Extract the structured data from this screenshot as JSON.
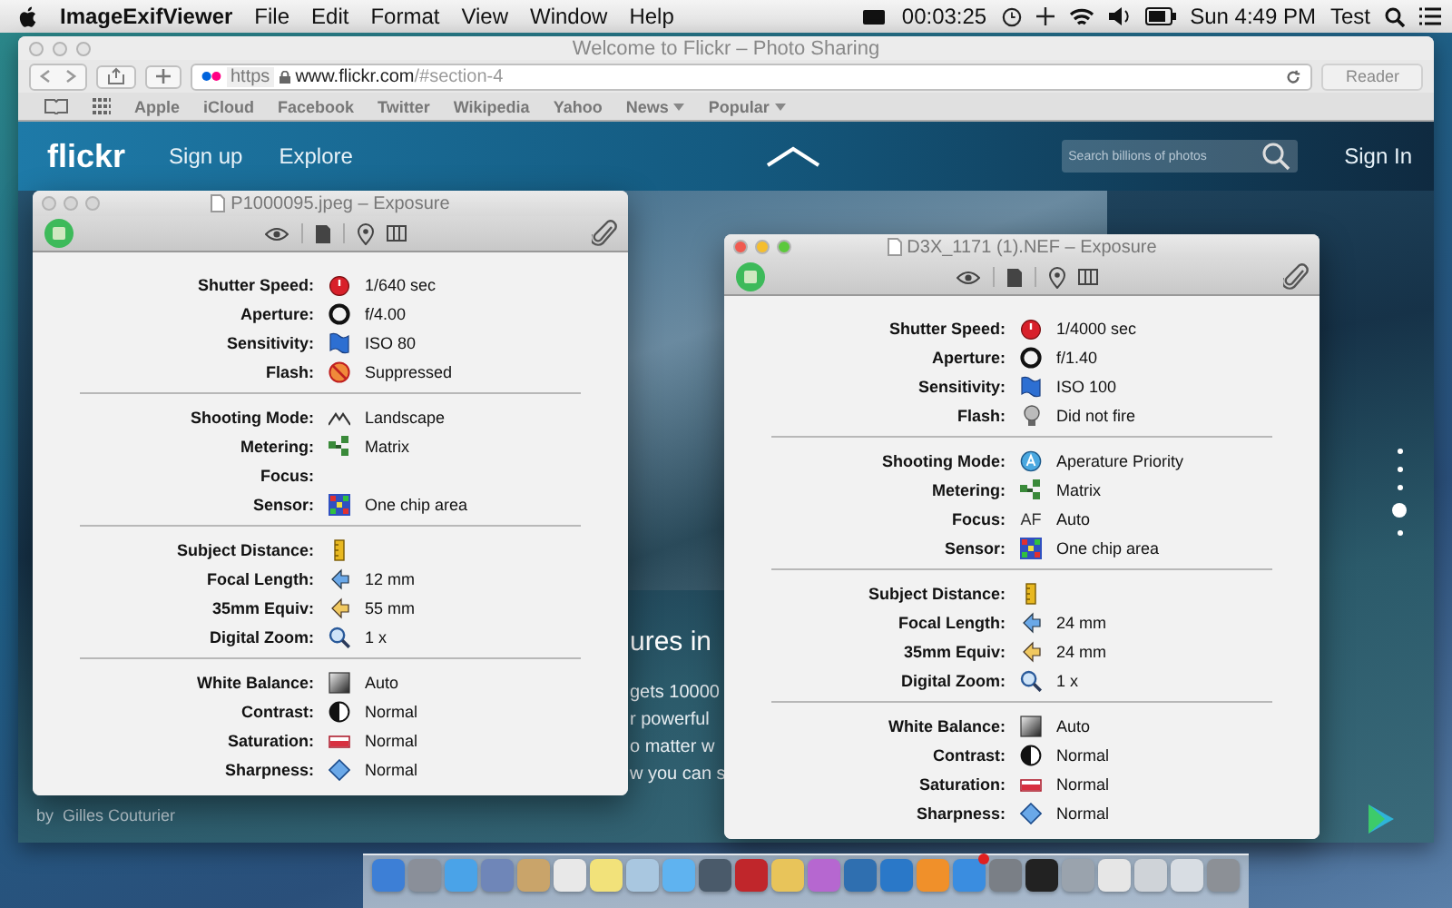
{
  "menubar": {
    "app_name": "ImageExifViewer",
    "menus": [
      "File",
      "Edit",
      "Format",
      "View",
      "Window",
      "Help"
    ],
    "timer": "00:03:25",
    "clock": "Sun 4:49 PM",
    "user": "Test"
  },
  "browser": {
    "title": "Welcome to Flickr – Photo Sharing",
    "url_scheme": "https",
    "url_host": "www.flickr.com",
    "url_path": "/#section-4",
    "reader_button": "Reader",
    "bookmarks": [
      {
        "label": "Apple",
        "menu": false
      },
      {
        "label": "iCloud",
        "menu": false
      },
      {
        "label": "Facebook",
        "menu": false
      },
      {
        "label": "Twitter",
        "menu": false
      },
      {
        "label": "Wikipedia",
        "menu": false
      },
      {
        "label": "Yahoo",
        "menu": false
      },
      {
        "label": "News",
        "menu": true
      },
      {
        "label": "Popular",
        "menu": true
      }
    ]
  },
  "page": {
    "logo": "flickr",
    "nav": [
      "Sign up",
      "Explore"
    ],
    "search_placeholder": "Search billions of photos",
    "sign_in": "Sign In",
    "headline": "ures in",
    "text_lines": [
      "gets 10000",
      "r powerful",
      "o matter w",
      "w you can s"
    ],
    "credit": "by  Gilles Couturier",
    "page_dots": [
      {
        "selected": false
      },
      {
        "selected": false
      },
      {
        "selected": false
      },
      {
        "selected": true
      },
      {
        "selected": false
      }
    ]
  },
  "panels": [
    {
      "title": "P1000095.jpeg – Exposure",
      "active": false,
      "groups": [
        [
          {
            "label": "Shutter Speed:",
            "kind": "shutter",
            "value": "1/640 sec"
          },
          {
            "label": "Aperture:",
            "kind": "aperture",
            "value": "f/4.00"
          },
          {
            "label": "Sensitivity:",
            "kind": "iso",
            "value": "ISO 80"
          },
          {
            "label": "Flash:",
            "kind": "flash",
            "value": "Suppressed"
          }
        ],
        [
          {
            "label": "Shooting Mode:",
            "kind": "landscape",
            "value": "Landscape"
          },
          {
            "label": "Metering:",
            "kind": "metering",
            "value": "Matrix"
          },
          {
            "label": "Focus:"
          },
          {
            "label": "Sensor:",
            "kind": "sensor",
            "value": "One chip area"
          }
        ],
        [
          {
            "label": "Subject Distance:",
            "kind": "distance"
          },
          {
            "label": "Focal Length:",
            "kind": "focal",
            "value": "12 mm"
          },
          {
            "label": "35mm Equiv:",
            "kind": "equiv",
            "value": "55 mm"
          },
          {
            "label": "Digital Zoom:",
            "kind": "zoom",
            "value": "1 x"
          }
        ],
        [
          {
            "label": "White Balance:",
            "kind": "wb",
            "value": "Auto"
          },
          {
            "label": "Contrast:",
            "kind": "contrast",
            "value": "Normal"
          },
          {
            "label": "Saturation:",
            "kind": "saturation",
            "value": "Normal"
          },
          {
            "label": "Sharpness:",
            "kind": "sharpness",
            "value": "Normal"
          }
        ]
      ]
    },
    {
      "title": "D3X_1171 (1).NEF – Exposure",
      "active": true,
      "groups": [
        [
          {
            "label": "Shutter Speed:",
            "kind": "shutter",
            "value": "1/4000 sec"
          },
          {
            "label": "Aperture:",
            "kind": "aperture",
            "value": "f/1.40"
          },
          {
            "label": "Sensitivity:",
            "kind": "iso",
            "value": "ISO 100"
          },
          {
            "label": "Flash:",
            "kind": "bulb",
            "value": "Did not fire"
          }
        ],
        [
          {
            "label": "Shooting Mode:",
            "kind": "priority",
            "value": "Aperature Priority"
          },
          {
            "label": "Metering:",
            "kind": "metering",
            "value": "Matrix"
          },
          {
            "label": "Focus:",
            "kind": "text",
            "icon_text": "AF",
            "value": "Auto"
          },
          {
            "label": "Sensor:",
            "kind": "sensor",
            "value": "One chip area"
          }
        ],
        [
          {
            "label": "Subject Distance:",
            "kind": "distance"
          },
          {
            "label": "Focal Length:",
            "kind": "focal",
            "value": "24 mm"
          },
          {
            "label": "35mm Equiv:",
            "kind": "equiv",
            "value": "24 mm"
          },
          {
            "label": "Digital Zoom:",
            "kind": "zoom",
            "value": "1 x"
          }
        ],
        [
          {
            "label": "White Balance:",
            "kind": "wb",
            "value": "Auto"
          },
          {
            "label": "Contrast:",
            "kind": "contrast",
            "value": "Normal"
          },
          {
            "label": "Saturation:",
            "kind": "saturation",
            "value": "Normal"
          },
          {
            "label": "Sharpness:",
            "kind": "sharpness",
            "value": "Normal"
          }
        ]
      ]
    }
  ],
  "dock": {
    "items": [
      {
        "color": "#3d7fd6",
        "badge": false
      },
      {
        "color": "#8a8f99",
        "badge": false
      },
      {
        "color": "#4aa3e8",
        "badge": false
      },
      {
        "color": "#6f86b8",
        "badge": false
      },
      {
        "color": "#c9a46a",
        "badge": false
      },
      {
        "color": "#e8e8e8",
        "badge": false
      },
      {
        "color": "#f2e27a",
        "badge": false
      },
      {
        "color": "#a9c7e0",
        "badge": false
      },
      {
        "color": "#5fb3f0",
        "badge": false
      },
      {
        "color": "#4a5a6a",
        "badge": false
      },
      {
        "color": "#c0262b",
        "badge": false
      },
      {
        "color": "#e8c45a",
        "badge": false
      },
      {
        "color": "#b667d0",
        "badge": false
      },
      {
        "color": "#2f6fb0",
        "badge": false
      },
      {
        "color": "#2a78c8",
        "badge": false
      },
      {
        "color": "#f0902a",
        "badge": false
      },
      {
        "color": "#3a8de0",
        "badge": true
      },
      {
        "color": "#7a7f86",
        "badge": false
      },
      {
        "color": "#222222",
        "badge": false
      },
      {
        "color": "#9aa3ad",
        "badge": false
      },
      {
        "color": "#e6e6e6",
        "badge": false
      },
      {
        "color": "#cfd3d8",
        "badge": false
      },
      {
        "color": "#d8dde3",
        "badge": false
      },
      {
        "color": "#8c9096",
        "badge": false
      }
    ]
  }
}
